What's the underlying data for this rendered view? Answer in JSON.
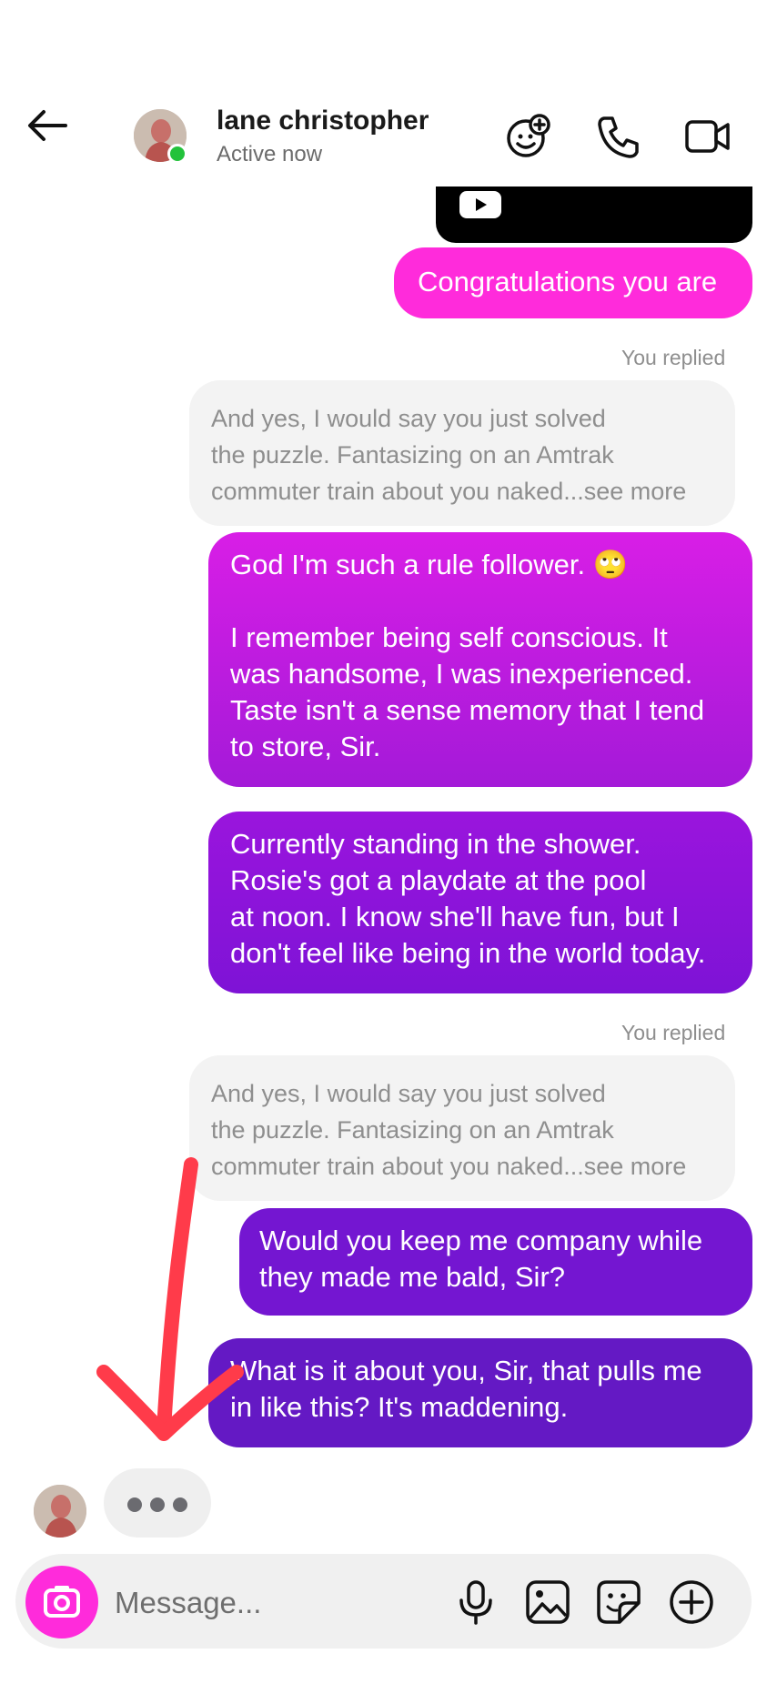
{
  "header": {
    "contact_name": "lane christopher",
    "status": "Active now",
    "icons": [
      "back-arrow-icon",
      "effects-icon",
      "phone-icon",
      "video-camera-icon"
    ],
    "online_color": "#23c23b"
  },
  "messages": {
    "congrats": "Congratulations you are",
    "replied_label_1": "You replied",
    "quote_1": "And yes, I would say you just solved\nthe puzzle. Fantasizing on an Amtrak\ncommuter train about you naked...see more",
    "rule_follower": "God I'm such a rule follower. 🙄\n\nI remember being self conscious. It\nwas handsome, I was inexperienced.\nTaste isn't a sense memory that I tend\nto store, Sir.",
    "shower": "Currently standing in the shower.\nRosie's got a playdate at the pool\nat noon. I know she'll have fun, but I\ndon't feel like being in the world today.",
    "replied_label_2": "You replied",
    "quote_2": "And yes, I would say you just solved\nthe puzzle. Fantasizing on an Amtrak\ncommuter train about you naked...see more",
    "bald": "Would you keep me company while\nthey made me bald, Sir?",
    "maddening": "What is it about you, Sir, that pulls me\nin like this? It's maddening."
  },
  "composer": {
    "placeholder": "Message...",
    "icons": [
      "camera-icon",
      "microphone-icon",
      "gallery-icon",
      "sticker-icon",
      "plus-icon"
    ]
  },
  "colors": {
    "sent_pink": "#ff2bdb",
    "sent_magenta": "#d21de4",
    "sent_purple": "#8d14dc",
    "sent_deep": "#6a16c6",
    "annotation_arrow": "#ff3b4a"
  }
}
